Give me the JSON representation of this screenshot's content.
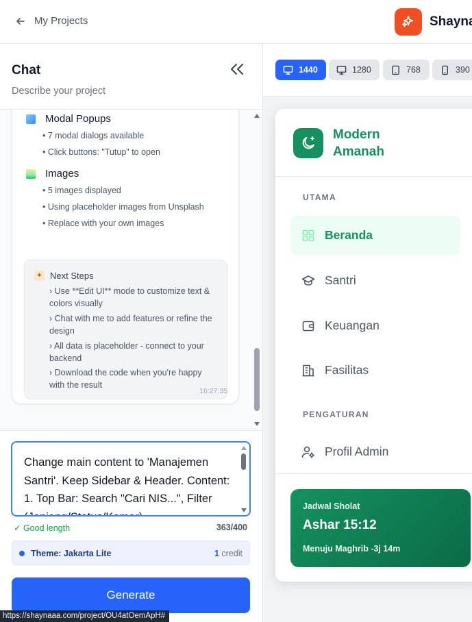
{
  "topbar": {
    "back_label": "My Projects",
    "brand_name": "Shaynaa"
  },
  "chat": {
    "title": "Chat",
    "subtitle": "Describe your project",
    "sections": [
      {
        "title": "Modal Popups",
        "icon": "window-icon",
        "bullets": [
          "• 7 modal dialogs available",
          "• Click buttons: \"Tutup\" to open"
        ]
      },
      {
        "title": "Images",
        "icon": "image-icon",
        "bullets": [
          "• 5 images displayed",
          "• Using placeholder images from Unsplash",
          "• Replace with your own images"
        ]
      }
    ],
    "next_steps": {
      "title": "Next Steps",
      "items": [
        "› Use **Edit UI** mode to customize text & colors visually",
        "› Chat with me to add features or refine the design",
        "› All data is placeholder - connect to your backend",
        "› Download the code when you're happy with the result"
      ]
    },
    "timestamp": "16:27:35"
  },
  "composer": {
    "prompt_text": "Change main content to 'Manajemen Santri'. Keep Sidebar & Header. Content: 1. Top Bar: Search \"Cari NIS...\", Filter (Jenjang/Status/Kamar).",
    "length_status": "✓ Good length",
    "char_count": "363/400",
    "theme_label": "Theme: Jakarta Lite",
    "credit_count": "1",
    "credit_label": "credit",
    "generate_label": "Generate"
  },
  "status_url": "https://shaynaaa.com/project/OU4atOemApH#",
  "viewports": [
    {
      "label": "1440",
      "icon": "monitor-icon",
      "active": true
    },
    {
      "label": "1280",
      "icon": "monitor-icon",
      "active": false
    },
    {
      "label": "768",
      "icon": "tablet-icon",
      "active": false
    },
    {
      "label": "390",
      "icon": "phone-icon",
      "active": false
    }
  ],
  "preview": {
    "app_name_line1": "Modern",
    "app_name_line2": "Amanah",
    "group_main": "UTAMA",
    "group_settings": "PENGATURAN",
    "nav": [
      "Beranda",
      "Santri",
      "Keuangan",
      "Fasilitas"
    ],
    "nav_settings": [
      "Profil Admin"
    ],
    "prayer": {
      "label": "Jadwal Sholat",
      "time": "Ashar 15:12",
      "next": "Menuju Maghrib -3j 14m"
    }
  },
  "colors": {
    "primary_blue": "#2563fb",
    "brand_orange": "#f04e23",
    "brand_green": "#15915f"
  }
}
